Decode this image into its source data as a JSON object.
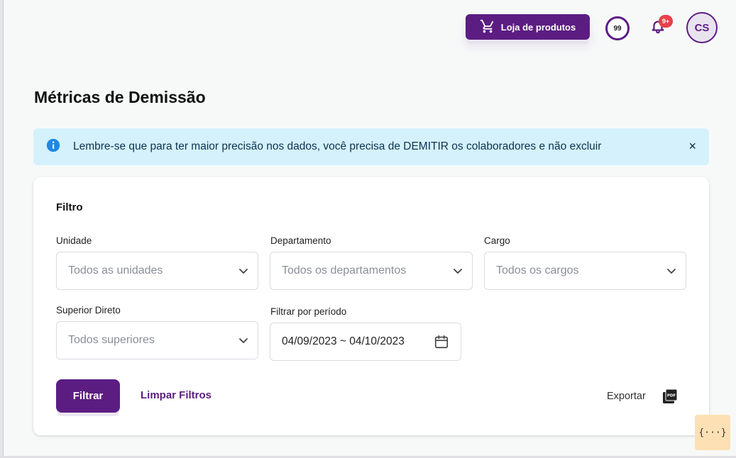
{
  "header": {
    "shop_button_label": "Loja de produtos",
    "points_value": "99",
    "notifications_badge": "9+",
    "avatar_initials": "CS"
  },
  "page": {
    "title": "Métricas de Demissão"
  },
  "alert": {
    "message": "Lembre-se que para ter maior precisão nos dados, você precisa de DEMITIR os colaboradores e não excluir",
    "close_symbol": "×"
  },
  "filter": {
    "title": "Filtro",
    "unit": {
      "label": "Unidade",
      "value": "Todos as unidades"
    },
    "department": {
      "label": "Departamento",
      "value": "Todos os departamentos"
    },
    "role": {
      "label": "Cargo",
      "value": "Todos os cargos"
    },
    "supervisor": {
      "label": "Superior Direto",
      "value": "Todos superiores"
    },
    "period": {
      "label": "Filtrar por período",
      "value": "04/09/2023 ~ 04/10/2023"
    },
    "filter_button": "Filtrar",
    "clear_button": "Limpar Filtros",
    "export_label": "Exportar"
  },
  "dev_tool": {
    "label": "{···}"
  },
  "colors": {
    "brand": "#5c1d82",
    "alert_bg": "#d4f1fc",
    "badge": "#e8404a",
    "background": "#f7f9f9"
  },
  "icons": [
    "cart-icon",
    "bell-icon",
    "info-icon",
    "close-icon",
    "chevron-down-icon",
    "calendar-icon",
    "pdf-icon"
  ]
}
